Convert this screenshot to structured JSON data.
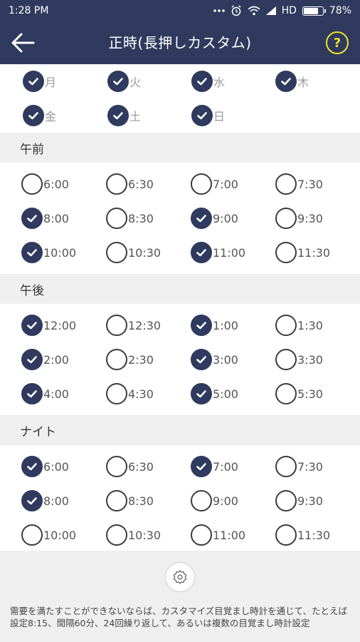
{
  "status": {
    "time": "1:28 PM",
    "signal": "HD",
    "battery": "78%",
    "battery_level": 0.78,
    "icons": [
      "more-dots-icon",
      "alarm-icon",
      "wifi-icon",
      "signal-icon",
      "battery-icon"
    ]
  },
  "appbar": {
    "title": "正時(長押しカスタム)",
    "back_icon": "arrow-left-icon",
    "help_label": "?"
  },
  "days": [
    {
      "label": "月",
      "checked": true
    },
    {
      "label": "火",
      "checked": true
    },
    {
      "label": "水",
      "checked": true
    },
    {
      "label": "木",
      "checked": true
    },
    {
      "label": "金",
      "checked": true
    },
    {
      "label": "土",
      "checked": true
    },
    {
      "label": "日",
      "checked": true
    }
  ],
  "sections": [
    {
      "title": "午前",
      "times": [
        {
          "label": "6:00",
          "checked": false
        },
        {
          "label": "6:30",
          "checked": false
        },
        {
          "label": "7:00",
          "checked": false
        },
        {
          "label": "7:30",
          "checked": false
        },
        {
          "label": "8:00",
          "checked": true
        },
        {
          "label": "8:30",
          "checked": false
        },
        {
          "label": "9:00",
          "checked": true
        },
        {
          "label": "9:30",
          "checked": false
        },
        {
          "label": "10:00",
          "checked": true
        },
        {
          "label": "10:30",
          "checked": false
        },
        {
          "label": "11:00",
          "checked": true
        },
        {
          "label": "11:30",
          "checked": false
        }
      ]
    },
    {
      "title": "午後",
      "times": [
        {
          "label": "12:00",
          "checked": true
        },
        {
          "label": "12:30",
          "checked": false
        },
        {
          "label": "1:00",
          "checked": true
        },
        {
          "label": "1:30",
          "checked": false
        },
        {
          "label": "2:00",
          "checked": true
        },
        {
          "label": "2:30",
          "checked": false
        },
        {
          "label": "3:00",
          "checked": true
        },
        {
          "label": "3:30",
          "checked": false
        },
        {
          "label": "4:00",
          "checked": true
        },
        {
          "label": "4:30",
          "checked": false
        },
        {
          "label": "5:00",
          "checked": true
        },
        {
          "label": "5:30",
          "checked": false
        }
      ]
    },
    {
      "title": "ナイト",
      "times": [
        {
          "label": "6:00",
          "checked": true
        },
        {
          "label": "6:30",
          "checked": false
        },
        {
          "label": "7:00",
          "checked": true
        },
        {
          "label": "7:30",
          "checked": false
        },
        {
          "label": "8:00",
          "checked": true
        },
        {
          "label": "8:30",
          "checked": false
        },
        {
          "label": "9:00",
          "checked": false
        },
        {
          "label": "9:30",
          "checked": false
        },
        {
          "label": "10:00",
          "checked": false
        },
        {
          "label": "10:30",
          "checked": false
        },
        {
          "label": "11:00",
          "checked": false
        },
        {
          "label": "11:30",
          "checked": false
        }
      ]
    }
  ],
  "footer": {
    "settings_icon": "gear-icon",
    "text": "需要を満たすことができないならば、カスタマイズ目覚まし時計を通じて、たとえば設定8:15、間隔60分、24回繰り返して、あるいは複数の目覚まし時計設定"
  },
  "colors": {
    "primary": "#2f3a5e",
    "help_accent": "#f3e225",
    "section_bg": "#efefef"
  }
}
